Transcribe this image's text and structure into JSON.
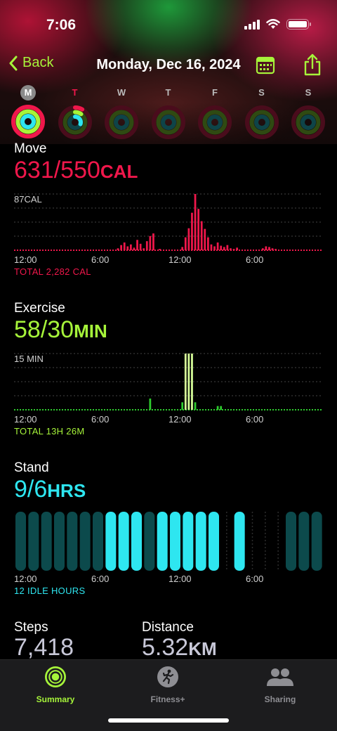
{
  "status_bar": {
    "time": "7:06"
  },
  "nav": {
    "back_label": "Back",
    "title": "Monday, Dec 16, 2024"
  },
  "week": [
    {
      "label": "M",
      "selected": true,
      "today": false
    },
    {
      "label": "T",
      "selected": false,
      "today": true
    },
    {
      "label": "W",
      "selected": false,
      "today": false
    },
    {
      "label": "T",
      "selected": false,
      "today": false
    },
    {
      "label": "F",
      "selected": false,
      "today": false
    },
    {
      "label": "S",
      "selected": false,
      "today": false
    },
    {
      "label": "S",
      "selected": false,
      "today": false
    }
  ],
  "colors": {
    "move": "#f0174b",
    "exercise": "#a6f43a",
    "stand": "#2ee6f0",
    "accent": "#a6f43a"
  },
  "move": {
    "label": "Move",
    "value": "631/550",
    "unit": "CAL",
    "max_label": "87CAL",
    "x_labels": [
      "12:00",
      "6:00",
      "12:00",
      "6:00"
    ],
    "total": "TOTAL 2,282 CAL"
  },
  "exercise": {
    "label": "Exercise",
    "value": "58/30",
    "unit": "MIN",
    "max_label": "15 MIN",
    "x_labels": [
      "12:00",
      "6:00",
      "12:00",
      "6:00"
    ],
    "total": "TOTAL 13H 26M"
  },
  "stand": {
    "label": "Stand",
    "value": "9/6",
    "unit": "HRS",
    "x_labels": [
      "12:00",
      "6:00",
      "12:00",
      "6:00"
    ],
    "idle": "12 IDLE HOURS"
  },
  "steps": {
    "label": "Steps",
    "value": "7,418"
  },
  "distance": {
    "label": "Distance",
    "value": "5.32",
    "unit": "KM"
  },
  "tabs": [
    {
      "label": "Summary",
      "active": true
    },
    {
      "label": "Fitness+",
      "active": false
    },
    {
      "label": "Sharing",
      "active": false
    }
  ],
  "chart_data": [
    {
      "type": "bar",
      "title": "Move",
      "unit": "CAL",
      "ylim": [
        0,
        87
      ],
      "x_ticks": [
        "12:00",
        "6:00",
        "12:00",
        "6:00"
      ],
      "bins": 96,
      "values": [
        0,
        0,
        0,
        0,
        0,
        0,
        0,
        0,
        0,
        0,
        0,
        0,
        0,
        0,
        0,
        0,
        0,
        0,
        0,
        0,
        0,
        0,
        0,
        0,
        0,
        0,
        0,
        0,
        0,
        0,
        0,
        0,
        3,
        8,
        12,
        6,
        9,
        4,
        16,
        10,
        3,
        14,
        22,
        26,
        0,
        2,
        0,
        0,
        0,
        0,
        0,
        0,
        5,
        20,
        34,
        58,
        87,
        64,
        45,
        33,
        20,
        9,
        6,
        12,
        7,
        5,
        8,
        3,
        2,
        4,
        0,
        0,
        0,
        0,
        0,
        0,
        0,
        3,
        6,
        5,
        3,
        2,
        0,
        0,
        0,
        0,
        0,
        0,
        0,
        0,
        0,
        0,
        0,
        0,
        0,
        0
      ]
    },
    {
      "type": "bar",
      "title": "Exercise",
      "unit": "MIN",
      "ylim": [
        0,
        15
      ],
      "x_ticks": [
        "12:00",
        "6:00",
        "12:00",
        "6:00"
      ],
      "bins": 96,
      "values": [
        0,
        0,
        0,
        0,
        0,
        0,
        0,
        0,
        0,
        0,
        0,
        0,
        0,
        0,
        0,
        0,
        0,
        0,
        0,
        0,
        0,
        0,
        0,
        0,
        0,
        0,
        0,
        0,
        0,
        0,
        0,
        0,
        0,
        0,
        0,
        0,
        0,
        0,
        0,
        0,
        0,
        0,
        3,
        0,
        0,
        0,
        0,
        0,
        0,
        0,
        0,
        0,
        2,
        15,
        15,
        15,
        2,
        0,
        0,
        0,
        0,
        0,
        0,
        1,
        1,
        0,
        0,
        0,
        0,
        0,
        0,
        0,
        0,
        0,
        0,
        0,
        0,
        0,
        0,
        0,
        0,
        0,
        0,
        0,
        0,
        0,
        0,
        0,
        0,
        0,
        0,
        0,
        0,
        0,
        0,
        0
      ],
      "highlight": [
        53,
        54,
        55
      ]
    },
    {
      "type": "bar",
      "title": "Stand",
      "unit": "HRS",
      "x_ticks": [
        "12:00",
        "6:00",
        "12:00",
        "6:00"
      ],
      "hours": 24,
      "stood": [
        0,
        0,
        0,
        0,
        0,
        0,
        0,
        1,
        1,
        1,
        0,
        1,
        1,
        1,
        1,
        1,
        0,
        1,
        0,
        0,
        0,
        0,
        0,
        0
      ],
      "idle": [
        1,
        1,
        1,
        1,
        1,
        1,
        1,
        0,
        0,
        0,
        1,
        0,
        0,
        0,
        0,
        0,
        0,
        0,
        0,
        0,
        0,
        1,
        1,
        1
      ]
    }
  ]
}
